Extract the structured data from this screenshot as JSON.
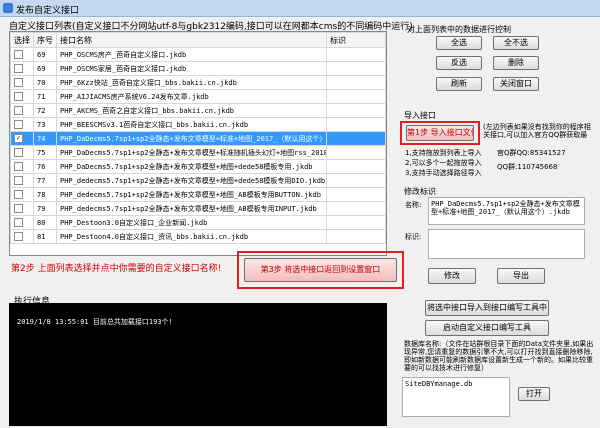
{
  "window": {
    "title": "发布自定义接口"
  },
  "list": {
    "heading": "自定义接口列表(自定义接口不分网站utf-8与gbk2312编码,接口可以在网都本cms的不同编码中运行)",
    "columns": [
      "选择",
      "序号",
      "接口名称",
      "标识"
    ],
    "rows": [
      {
        "no": "69",
        "name": "PHP_OSCMS房产_芭奇自定义接口.jkdb",
        "checked": false,
        "sel": false
      },
      {
        "no": "69",
        "name": "PHP_OSCMS家居_芭奇自定义接口.jkdb",
        "checked": false,
        "sel": false
      },
      {
        "no": "70",
        "name": "PHP_6Kzz快站_芭奇自定义接口_bbs.bakii.cn.jkdb",
        "checked": false,
        "sel": false
      },
      {
        "no": "71",
        "name": "PHP_AIJIACMS房产系统V6.24发布文章.jkdb",
        "checked": false,
        "sel": false
      },
      {
        "no": "72",
        "name": "PHP_AKCMS_芭奇之自定义接口_bbs.bakii.cn.jkdb",
        "checked": false,
        "sel": false
      },
      {
        "no": "73",
        "name": "PHP_BEESCMSv3.1芭奇自定义接口_bbs.bakii.cn.jkdb",
        "checked": false,
        "sel": false
      },
      {
        "no": "74",
        "name": "PHP_DaDecms5.7sp1+sp2全静态+发布文章模型+标准+地图_2017_（默认用这个）.jkdb",
        "checked": true,
        "sel": true
      },
      {
        "no": "75",
        "name": "PHP_DaDecms5.7sp1+sp2全静态+发布文章模型+标准随机插头幻灯+地图rss_2018.jkdb",
        "checked": false,
        "sel": false
      },
      {
        "no": "76",
        "name": "PHP_DaDecms5.7sp1+sp2全静态+发布文章模型+地图+dede58模板专用.jkdb",
        "checked": false,
        "sel": false
      },
      {
        "no": "77",
        "name": "PHP_dedecms5.7sp1+sp2全静态+发布文章模型+地图+dede58模板专用DIO.jkdb",
        "checked": false,
        "sel": false
      },
      {
        "no": "78",
        "name": "PHP_dedecms5.7sp1+sp2全静态+发布文章模型+地图_AB模板专用BUTTON.jkdb",
        "checked": false,
        "sel": false
      },
      {
        "no": "79",
        "name": "PHP_dedecms5.7sp1+sp2全静态+发布文章模型+地图_AB模板专用INPUT.jkdb",
        "checked": false,
        "sel": false
      },
      {
        "no": "80",
        "name": "PHP_Destoon3.0自定义接口_企业新闻.jkdb",
        "checked": false,
        "sel": false
      },
      {
        "no": "81",
        "name": "PHP_Destoon4.0自定义接口_资讯_bbs.bakii.cn.jkdb",
        "checked": false,
        "sel": false
      }
    ]
  },
  "step2": "第2步 上面列表选择并点中你需要的自定义接口名称!",
  "step3": "第3步 将选中接口返回到设置窗口",
  "log": {
    "title": "执行信息",
    "line": "2019/1/8 13:55:01  目前总共加载接口193个!"
  },
  "control": {
    "title": "对上面列表中的数据进行控制",
    "all": "全选",
    "none": "全不选",
    "invert": "反选",
    "delete": "删除",
    "refresh": "刷新",
    "close": "关闭窗口"
  },
  "import": {
    "title": "导入接口",
    "step1": "第1步 导入接口文件",
    "note": "(左边列表如果没有找到你的程序相关接口,可以加入官方QQ群获取最新的接口或者定制)",
    "group": "官Q群QQ:85341527",
    "qq": "QQ群:110745668",
    "tips": [
      "1,支持拖放到列表上导入",
      "2,可以多个一起拖放导入",
      "3,支持手动选择路径导入"
    ]
  },
  "modify": {
    "title": "修改标识",
    "name_label": "名称:",
    "name_value": "PHP_DaDecms5.7sp1+sp2全静态+发布文章模型+标准+地图_2017_（默认用这个）.jkdb",
    "flag_label": "标识:",
    "edit": "修改",
    "export": "导出"
  },
  "tools": {
    "import_to_editor": "将选中接口导入到接口编写工具中",
    "launch_editor": "启动自定义接口编写工具"
  },
  "db": {
    "note": "数据库名称:（文件在站群根目录下面的Data文件夹里,如果出现异常,您请重复的数据引擎不大,可以打开找到直接删除移除,即如新数据可能刷新数据库设置新生成一个新的。如果比较重要的可以找技术进行修复）",
    "file": "SiteDBYmanage.db",
    "open": "打开"
  }
}
